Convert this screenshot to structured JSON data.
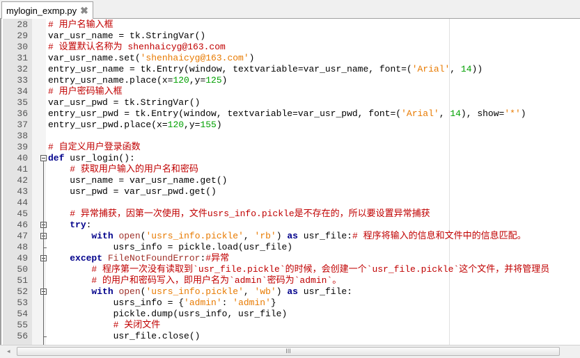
{
  "tab": {
    "title": "mylogin_exmp.py",
    "close_icon": "close-icon"
  },
  "lines": [
    {
      "n": "28",
      "t": [
        [
          "c",
          "# 用户名输入框"
        ]
      ]
    },
    {
      "n": "29",
      "t": [
        [
          "p",
          "var_usr_name = tk.StringVar()"
        ]
      ]
    },
    {
      "n": "30",
      "t": [
        [
          "c",
          "# 设置默认名称为 shenhaicyg@163.com"
        ]
      ]
    },
    {
      "n": "31",
      "t": [
        [
          "p",
          "var_usr_name.set("
        ],
        [
          "s",
          "'shenhaicyg@163.com'"
        ],
        [
          "p",
          ")"
        ]
      ]
    },
    {
      "n": "32",
      "t": [
        [
          "p",
          "entry_usr_name = tk.Entry(window, textvariable=var_usr_name, font=("
        ],
        [
          "s",
          "'Arial'"
        ],
        [
          "p",
          ", "
        ],
        [
          "n",
          "14"
        ],
        [
          "p",
          "))"
        ]
      ]
    },
    {
      "n": "33",
      "t": [
        [
          "p",
          "entry_usr_name.place(x="
        ],
        [
          "n",
          "120"
        ],
        [
          "p",
          ",y="
        ],
        [
          "n",
          "125"
        ],
        [
          "p",
          ")"
        ]
      ]
    },
    {
      "n": "34",
      "t": [
        [
          "c",
          "# 用户密码输入框"
        ]
      ]
    },
    {
      "n": "35",
      "t": [
        [
          "p",
          "var_usr_pwd = tk.StringVar()"
        ]
      ]
    },
    {
      "n": "36",
      "t": [
        [
          "p",
          "entry_usr_pwd = tk.Entry(window, textvariable=var_usr_pwd, font=("
        ],
        [
          "s",
          "'Arial'"
        ],
        [
          "p",
          ", "
        ],
        [
          "n",
          "14"
        ],
        [
          "p",
          "), show="
        ],
        [
          "s",
          "'*'"
        ],
        [
          "p",
          ")"
        ]
      ]
    },
    {
      "n": "37",
      "t": [
        [
          "p",
          "entry_usr_pwd.place(x="
        ],
        [
          "n",
          "120"
        ],
        [
          "p",
          ",y="
        ],
        [
          "n",
          "155"
        ],
        [
          "p",
          ")"
        ]
      ]
    },
    {
      "n": "38",
      "t": []
    },
    {
      "n": "39",
      "t": [
        [
          "c",
          "# 自定义用户登录函数"
        ]
      ]
    },
    {
      "n": "40",
      "t": [
        [
          "k",
          "def"
        ],
        [
          "p",
          " usr_login():"
        ]
      ]
    },
    {
      "n": "41",
      "t": [
        [
          "p",
          "    "
        ],
        [
          "c",
          "# 获取用户输入的用户名和密码"
        ]
      ]
    },
    {
      "n": "42",
      "t": [
        [
          "p",
          "    usr_name = var_usr_name.get()"
        ]
      ]
    },
    {
      "n": "43",
      "t": [
        [
          "p",
          "    usr_pwd = var_usr_pwd.get()"
        ]
      ]
    },
    {
      "n": "44",
      "t": []
    },
    {
      "n": "45",
      "t": [
        [
          "p",
          "    "
        ],
        [
          "c",
          "# 异常捕获，因第一次使用，文件usrs_info.pickle是不存在的，所以要设置异常捕获"
        ]
      ]
    },
    {
      "n": "46",
      "t": [
        [
          "p",
          "    "
        ],
        [
          "k",
          "try"
        ],
        [
          "p",
          ":"
        ]
      ]
    },
    {
      "n": "47",
      "t": [
        [
          "p",
          "        "
        ],
        [
          "k",
          "with"
        ],
        [
          "p",
          " "
        ],
        [
          "b",
          "open"
        ],
        [
          "p",
          "("
        ],
        [
          "s",
          "'usrs_info.pickle'"
        ],
        [
          "p",
          ", "
        ],
        [
          "s",
          "'rb'"
        ],
        [
          "p",
          ") "
        ],
        [
          "k",
          "as"
        ],
        [
          "p",
          " usr_file:"
        ],
        [
          "c",
          "# 程序将输入的信息和文件中的信息匹配。"
        ]
      ]
    },
    {
      "n": "48",
      "t": [
        [
          "p",
          "            usrs_info = pickle.load(usr_file)"
        ]
      ]
    },
    {
      "n": "49",
      "t": [
        [
          "p",
          "    "
        ],
        [
          "k",
          "except"
        ],
        [
          "p",
          " "
        ],
        [
          "e",
          "FileNotFoundError"
        ],
        [
          "p",
          ":"
        ],
        [
          "c",
          "#异常"
        ]
      ]
    },
    {
      "n": "50",
      "t": [
        [
          "p",
          "        "
        ],
        [
          "c",
          "# 程序第一次没有读取到`usr_file.pickle`的时候，会创建一个`usr_file.pickle`这个文件，并将管理员"
        ]
      ]
    },
    {
      "n": "51",
      "t": [
        [
          "p",
          "        "
        ],
        [
          "c",
          "# 的用户和密码写入，即用户名为`admin`密码为`admin`。"
        ]
      ]
    },
    {
      "n": "52",
      "t": [
        [
          "p",
          "        "
        ],
        [
          "k",
          "with"
        ],
        [
          "p",
          " "
        ],
        [
          "b",
          "open"
        ],
        [
          "p",
          "("
        ],
        [
          "s",
          "'usrs_info.pickle'"
        ],
        [
          "p",
          ", "
        ],
        [
          "s",
          "'wb'"
        ],
        [
          "p",
          ") "
        ],
        [
          "k",
          "as"
        ],
        [
          "p",
          " usr_file:"
        ]
      ]
    },
    {
      "n": "53",
      "t": [
        [
          "p",
          "            usrs_info = {"
        ],
        [
          "s",
          "'admin'"
        ],
        [
          "p",
          ": "
        ],
        [
          "s",
          "'admin'"
        ],
        [
          "p",
          "}"
        ]
      ]
    },
    {
      "n": "54",
      "t": [
        [
          "p",
          "            pickle.dump(usrs_info, usr_file)"
        ]
      ]
    },
    {
      "n": "55",
      "t": [
        [
          "p",
          "            "
        ],
        [
          "c",
          "# 关闭文件"
        ]
      ]
    },
    {
      "n": "56",
      "t": [
        [
          "p",
          "            usr_file.close()"
        ]
      ]
    }
  ],
  "folds": [
    "40",
    "46",
    "47",
    "49",
    "52"
  ],
  "scrollbar": {
    "left_arrow": "◂",
    "grip": "III"
  }
}
